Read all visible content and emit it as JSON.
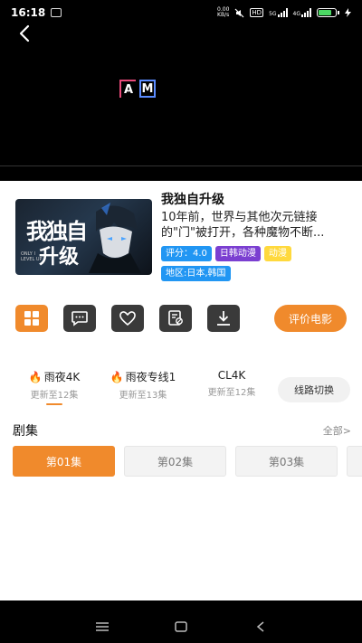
{
  "status_bar": {
    "time": "16:18",
    "net_speed": "0.00\nKB/s",
    "signal1": "HD",
    "signal2": "5G",
    "signal3": "4G",
    "battery_level": 0.8,
    "icons": [
      "notification-icon",
      "mute-icon",
      "hd-icon",
      "signal-icon",
      "battery-icon",
      "charging-icon"
    ]
  },
  "player": {
    "logo_text_a": "A",
    "logo_text_m": "M"
  },
  "show": {
    "title": "我独自升级",
    "description": "10年前，世界与其他次元链接的\"门\"被打开，各种魔物不断...",
    "poster_title_line1": "我独自",
    "poster_title_line2": "升级",
    "poster_caption": "ONLY I LEVEL UP",
    "rating_tag": "评分：4.0",
    "genre_tag": "日韩动漫",
    "type_tag": "动漫",
    "region_tag": "地区:日本,韩国"
  },
  "actions": {
    "rate_label": "评价电影",
    "icons": [
      "grid-icon",
      "comment-icon",
      "heart-icon",
      "report-icon",
      "download-icon"
    ]
  },
  "lines": [
    {
      "name": "雨夜4K",
      "fire": true,
      "sub": "更新至12集",
      "active": true
    },
    {
      "name": "雨夜专线1",
      "fire": true,
      "sub": "更新至13集",
      "active": false
    },
    {
      "name": "CL4K",
      "fire": false,
      "sub": "更新至12集",
      "active": false
    }
  ],
  "switch_label": "线路切换",
  "episodes": {
    "title": "剧集",
    "all_label": "全部>",
    "items": [
      "第01集",
      "第02集",
      "第03集"
    ],
    "active_index": 0
  },
  "colors": {
    "accent": "#f08a2c",
    "dark_button": "#3a3a3a",
    "tag_blue": "#2196f3",
    "tag_purple": "#7b3fd1",
    "tag_yellow": "#ffd93d"
  }
}
